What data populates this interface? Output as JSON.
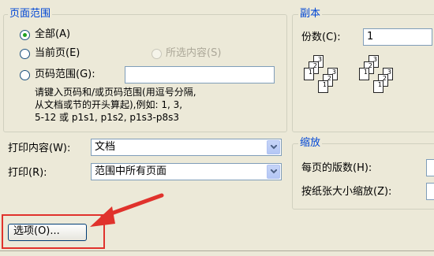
{
  "page_range": {
    "legend": "页面范围",
    "all_label": "全部(A)",
    "current_label": "当前页(E)",
    "selection_label": "所选内容(S)",
    "pages_label": "页码范围(G):",
    "pages_value": "",
    "hint_line1": "请键入页码和/或页码范围(用逗号分隔,",
    "hint_line2": "从文档或节的开头算起),例如: 1, 3,",
    "hint_line3": "5-12 或 p1s1, p1s2, p1s3-p8s3",
    "selected_option": "all"
  },
  "copies": {
    "legend": "副本",
    "count_label": "份数(C):",
    "count_value": "1"
  },
  "print_what": {
    "label": "打印内容(W):",
    "value": "文档"
  },
  "print_range": {
    "label": "打印(R):",
    "value": "范围中所有页面"
  },
  "zoom": {
    "legend": "缩放",
    "pages_per_sheet_label": "每页的版数(H):",
    "scale_to_paper_label": "按纸张大小缩放(Z):"
  },
  "options_button": {
    "label": "选项(O)..."
  },
  "colors": {
    "dialog_bg": "#ece9d8",
    "legend_text": "#0046d5",
    "highlight": "#e0322c"
  }
}
